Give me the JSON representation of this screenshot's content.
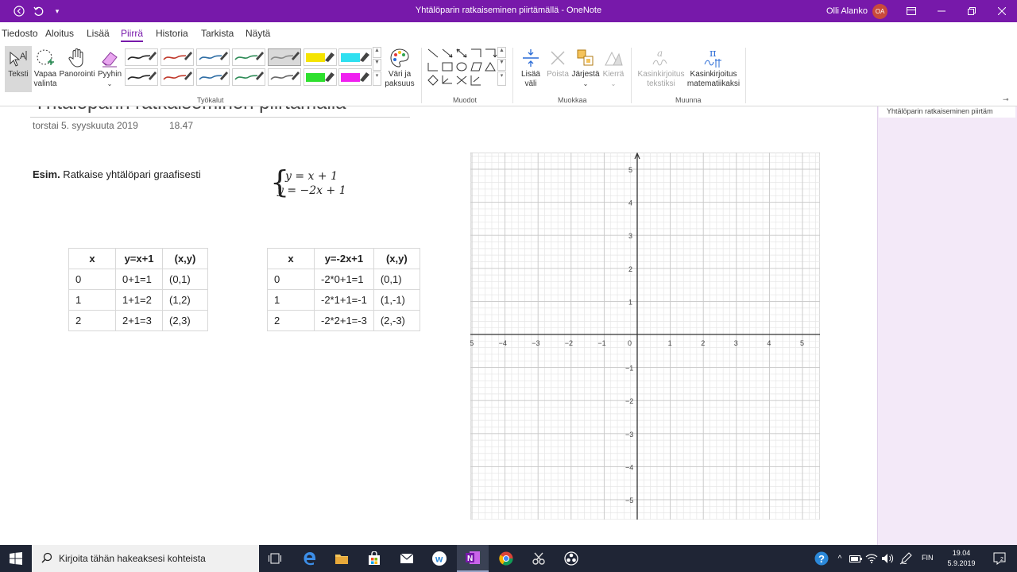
{
  "titlebar": {
    "title": "Yhtälöparin ratkaiseminen piirtämällä  -  OneNote",
    "user_name": "Olli Alanko",
    "user_initials": "OA"
  },
  "tabs": [
    {
      "label": "Tiedosto"
    },
    {
      "label": "Aloitus"
    },
    {
      "label": "Lisää"
    },
    {
      "label": "Piirrä",
      "active": true
    },
    {
      "label": "Historia"
    },
    {
      "label": "Tarkista"
    },
    {
      "label": "Näytä"
    }
  ],
  "ribbon": {
    "tools": {
      "text_label": "Teksti",
      "lasso_label_1": "Vapaa",
      "lasso_label_2": "valinta",
      "pan_label": "Panorointi",
      "eraser_label": "Pyyhin",
      "color_label_1": "Väri ja",
      "color_label_2": "paksuus",
      "group_label": "Työkalut"
    },
    "pens_top": [
      "#222222",
      "#c0392b",
      "#2e6da4",
      "#2e8b57",
      "#888888",
      "#f5e400",
      "#2fe0f0"
    ],
    "pens_bottom": [
      "#222222",
      "#c0392b",
      "#2e6da4",
      "#2e8b57",
      "#666666",
      "#2ee02e",
      "#f020f0"
    ],
    "shapes_group_label": "Muodot",
    "edit": {
      "insert_space_1": "Lisää",
      "insert_space_2": "väli",
      "delete_label": "Poista",
      "arrange_label": "Järjestä",
      "rotate_label": "Kierrä",
      "group_label": "Muokkaa"
    },
    "convert": {
      "ink_to_text_1": "Kasinkirjoitus",
      "ink_to_text_2": "tekstiksi",
      "ink_to_math_1": "Kasinkirjoitus",
      "ink_to_math_2": "matematiikaksi",
      "group_label": "Muunna"
    }
  },
  "page": {
    "title": "Yhtälöparin ratkaiseminen piirtämällä",
    "date": "torstai 5. syyskuuta 2019",
    "time": "18.47",
    "example_bold": "Esim.",
    "example_text": " Ratkaise yhtälöpari graafisesti",
    "equations": {
      "eq1": "y = x + 1",
      "eq2": "y = −2x + 1"
    }
  },
  "table1": {
    "headers": [
      "x",
      "y=x+1",
      "(x,y)"
    ],
    "rows": [
      [
        "0",
        "0+1=1",
        "(0,1)"
      ],
      [
        "1",
        "1+1=2",
        "(1,2)"
      ],
      [
        "2",
        "2+1=3",
        "(2,3)"
      ]
    ]
  },
  "table2": {
    "headers": [
      "x",
      "y=-2x+1",
      "(x,y)"
    ],
    "rows": [
      [
        "0",
        "-2*0+1=1",
        "(0,1)"
      ],
      [
        "1",
        "-2*1+1=-1",
        "(1,-1)"
      ],
      [
        "2",
        "-2*2+1=-3",
        "(2,-3)"
      ]
    ]
  },
  "graph": {
    "x_ticks": [
      "-5",
      "-4",
      "-3",
      "-2",
      "-1",
      "0",
      "1",
      "2",
      "3",
      "4",
      "5"
    ],
    "y_ticks": [
      "5",
      "4",
      "3",
      "2",
      "1",
      "-1",
      "-2",
      "-3",
      "-4",
      "-5"
    ],
    "x_range": [
      -5.2,
      5.4
    ],
    "y_range": [
      -5.5,
      5.5
    ]
  },
  "sidebar": {
    "page_item": "Yhtälöparin ratkaiseminen piirtäm"
  },
  "taskbar": {
    "search_placeholder": "Kirjoita tähän hakeaksesi kohteista",
    "language": "FIN",
    "time": "19.04",
    "date": "5.9.2019"
  }
}
